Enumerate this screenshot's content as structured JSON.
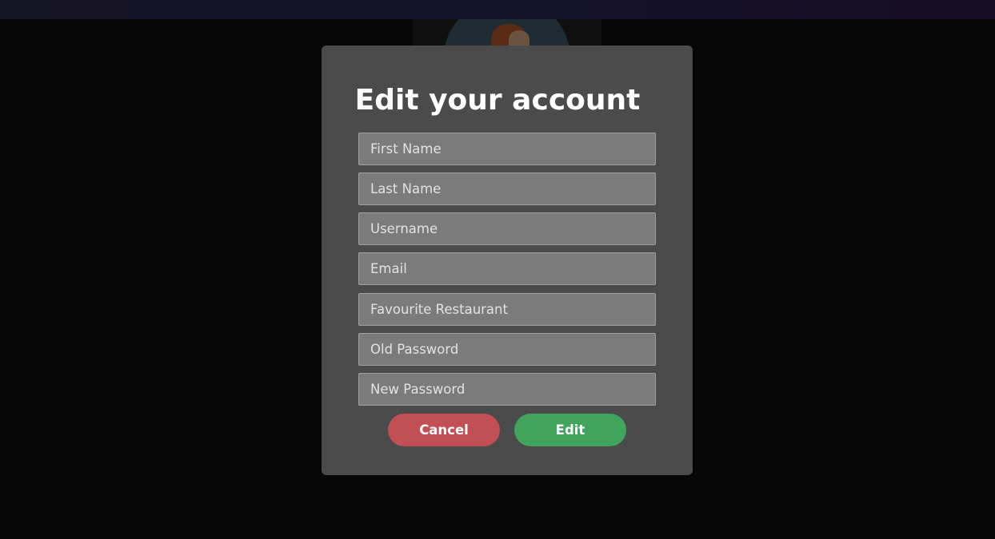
{
  "modal": {
    "title": "Edit your account",
    "fields": {
      "first_name": {
        "placeholder": "First Name",
        "value": ""
      },
      "last_name": {
        "placeholder": "Last Name",
        "value": ""
      },
      "username": {
        "placeholder": "Username",
        "value": ""
      },
      "email": {
        "placeholder": "Email",
        "value": ""
      },
      "favourite_restaurant": {
        "placeholder": "Favourite Restaurant",
        "value": ""
      },
      "old_password": {
        "placeholder": "Old Password",
        "value": ""
      },
      "new_password": {
        "placeholder": "New Password",
        "value": ""
      }
    },
    "buttons": {
      "cancel_label": "Cancel",
      "edit_label": "Edit"
    }
  },
  "colors": {
    "modal_background": "#4b4b4b",
    "input_background": "#7b7b7b",
    "cancel": "#c24f54",
    "edit": "#40a45c",
    "page_background": "#070707"
  }
}
